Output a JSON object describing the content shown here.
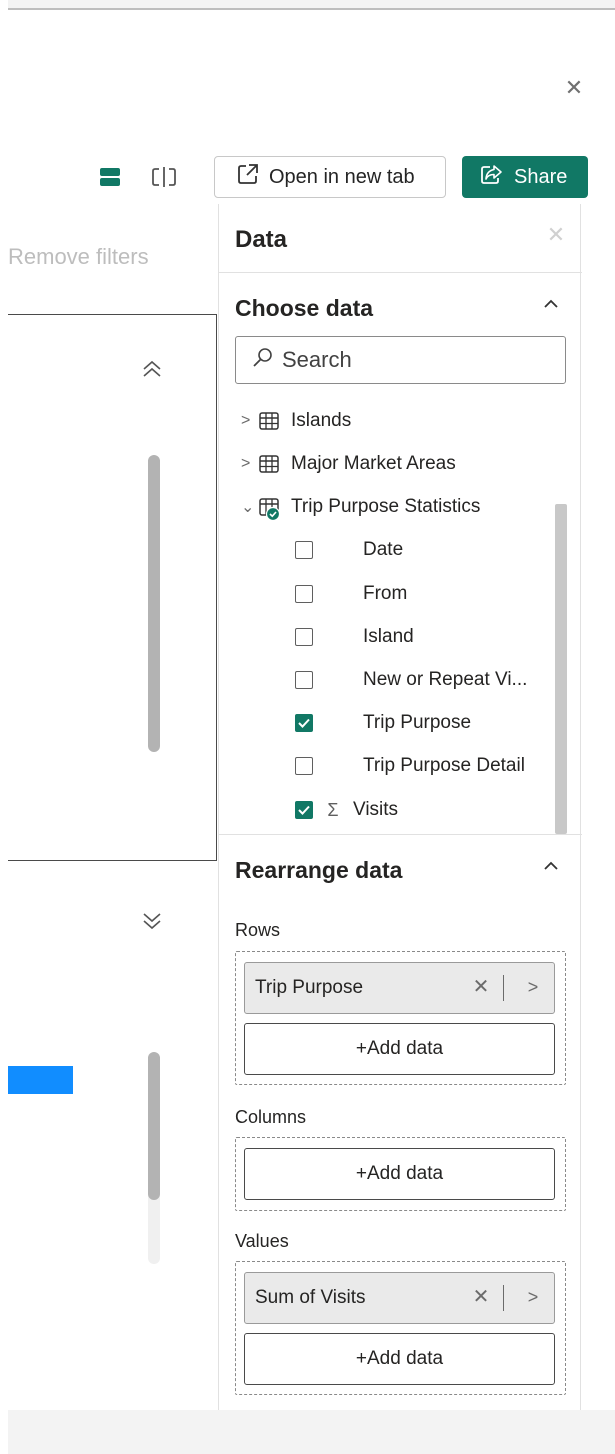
{
  "window": {
    "close_icon": "close-icon"
  },
  "toolbar": {
    "layout_icon": "stacked-layout-icon",
    "split_icon": "split-view-icon",
    "open_label": "Open in new tab",
    "share_label": "Share",
    "share_color": "#117865"
  },
  "canvas": {
    "remove_filters_label": "Remove filters",
    "accent_bar_color": "#118dff"
  },
  "data_pane": {
    "title": "Data",
    "choose_data": {
      "title": "Choose data",
      "search_placeholder": "Search",
      "tables": [
        {
          "label": "Islands",
          "expanded": false
        },
        {
          "label": "Major Market Areas",
          "expanded": false
        },
        {
          "label": "Trip Purpose Statistics",
          "expanded": true
        }
      ],
      "fields": [
        {
          "label": "Date",
          "checked": false,
          "sigma": ""
        },
        {
          "label": "From",
          "checked": false,
          "sigma": ""
        },
        {
          "label": "Island",
          "checked": false,
          "sigma": ""
        },
        {
          "label": "New or Repeat Vi...",
          "checked": false,
          "sigma": ""
        },
        {
          "label": "Trip Purpose",
          "checked": true,
          "sigma": ""
        },
        {
          "label": "Trip Purpose Detail",
          "checked": false,
          "sigma": ""
        },
        {
          "label": "Visits",
          "checked": true,
          "sigma": "Σ"
        }
      ]
    },
    "rearrange": {
      "title": "Rearrange data",
      "rows_label": "Rows",
      "rows_pill": "Trip Purpose",
      "columns_label": "Columns",
      "values_label": "Values",
      "values_pill": "Sum of Visits",
      "add_data_label": "+Add data"
    }
  }
}
